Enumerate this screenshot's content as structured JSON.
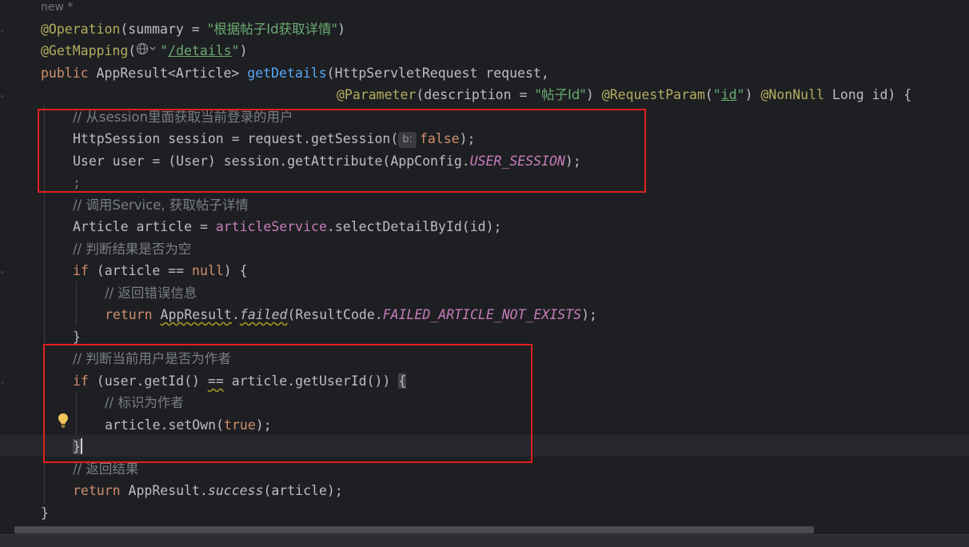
{
  "editor": {
    "author_hint": "new *",
    "inlay_hint_param": "b:",
    "lines": {
      "l1": {
        "ann": "@Operation",
        "p1": "(summary = ",
        "str": "\"根据帖子Id获取详情\"",
        "p2": ")"
      },
      "l2": {
        "ann": "@GetMapping",
        "p1": "(",
        "q1": "\"",
        "link": "/details",
        "q2": "\"",
        "p2": ")"
      },
      "l3": {
        "kw": "public",
        "type": " AppResult<Article> ",
        "fn": "getDetails",
        "rest": "(HttpServletRequest request,"
      },
      "l4": {
        "ann1": "@Parameter",
        "p1": "(description = ",
        "str": "\"帖子Id\"",
        "p2": ") ",
        "ann2": "@RequestParam",
        "p3": "(",
        "q1": "\"",
        "link": "id",
        "q2": "\"",
        "p4": ") ",
        "ann3": "@NonNull",
        "p5": " Long id) {"
      },
      "l5": {
        "cmt": "// 从session里面获取当前登录的用户"
      },
      "l6": {
        "p1": "HttpSession session = request.getSession(",
        "kw": "false",
        "p2": ");"
      },
      "l7": {
        "p1": "User user = (User) session.getAttribute(AppConfig.",
        "const": "USER_SESSION",
        "p2": ");"
      },
      "l8": {
        "cmt": ";"
      },
      "l9": {
        "cmt": "// 调用Service, 获取帖子详情"
      },
      "l10": {
        "p1": "Article article = ",
        "field": "articleService",
        "p2": ".selectDetailById(id);"
      },
      "l11": {
        "cmt": "// 判断结果是否为空"
      },
      "l12": {
        "kw1": "if",
        "p1": " (article == ",
        "kw2": "null",
        "p2": ") {"
      },
      "l13": {
        "cmt": "// 返回错误信息"
      },
      "l14": {
        "kw": "return",
        "sp": " ",
        "cls": "AppResult",
        "dot": ".",
        "call": "failed",
        "p1": "(ResultCode.",
        "const": "FAILED_ARTICLE_NOT_EXISTS",
        "p2": ");"
      },
      "l15": {
        "p1": "}"
      },
      "l16": {
        "cmt": "// 判断当前用户是否为作者"
      },
      "l17": {
        "kw": "if",
        "p1": " (user.getId() ",
        "eq": "==",
        "p2": " article.getUserId()) ",
        "brace": "{"
      },
      "l18": {
        "cmt": "// 标识为作者"
      },
      "l19": {
        "p1": "article.setOwn(",
        "kw": "true",
        "p2": ");"
      },
      "l20": {
        "brace": "}"
      },
      "l21": {
        "cmt": "// 返回结果"
      },
      "l22": {
        "kw": "return",
        "p1": " AppResult.",
        "call": "success",
        "p2": "(article);"
      },
      "l23": {
        "p1": "}"
      }
    }
  },
  "colors": {
    "background": "#1e1f22",
    "keyword": "#cf8e6d",
    "annotation": "#b3ae60",
    "string": "#6aab73",
    "method_decl": "#56a8f5",
    "comment": "#7a7e85",
    "constant": "#c77dbb",
    "highlight_box": "#e02020"
  },
  "icons": {
    "globe": "globe-icon",
    "bulb": "lightbulb-icon"
  }
}
